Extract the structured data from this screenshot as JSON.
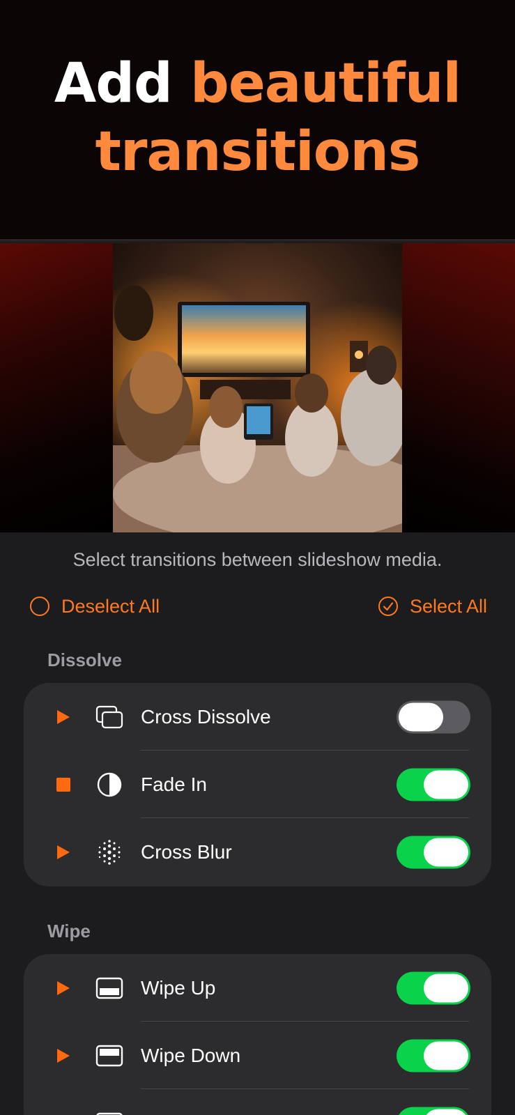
{
  "hero": {
    "title_white": "Add",
    "title_orange_1": "beautiful",
    "title_orange_2": "transitions"
  },
  "subtitle": "Select transitions between slideshow media.",
  "deselect_all": "Deselect All",
  "select_all": "Select All",
  "colors": {
    "accent": "#ff7a1f",
    "title_accent": "#ff8a3d",
    "toggle_on": "#0ad24a",
    "card": "#2c2c2e",
    "background": "#1c1c1e"
  },
  "sections": [
    {
      "title": "Dissolve",
      "items": [
        {
          "label": "Cross Dissolve",
          "control": "play",
          "icon": "cross-dissolve-icon",
          "enabled": false
        },
        {
          "label": "Fade In",
          "control": "stop",
          "icon": "fade-in-icon",
          "enabled": true
        },
        {
          "label": "Cross Blur",
          "control": "play",
          "icon": "cross-blur-icon",
          "enabled": true
        }
      ]
    },
    {
      "title": "Wipe",
      "items": [
        {
          "label": "Wipe Up",
          "control": "play",
          "icon": "wipe-up-icon",
          "enabled": true
        },
        {
          "label": "Wipe Down",
          "control": "play",
          "icon": "wipe-down-icon",
          "enabled": true
        },
        {
          "label": "",
          "control": "play",
          "icon": "wipe-icon",
          "enabled": true
        }
      ]
    }
  ]
}
